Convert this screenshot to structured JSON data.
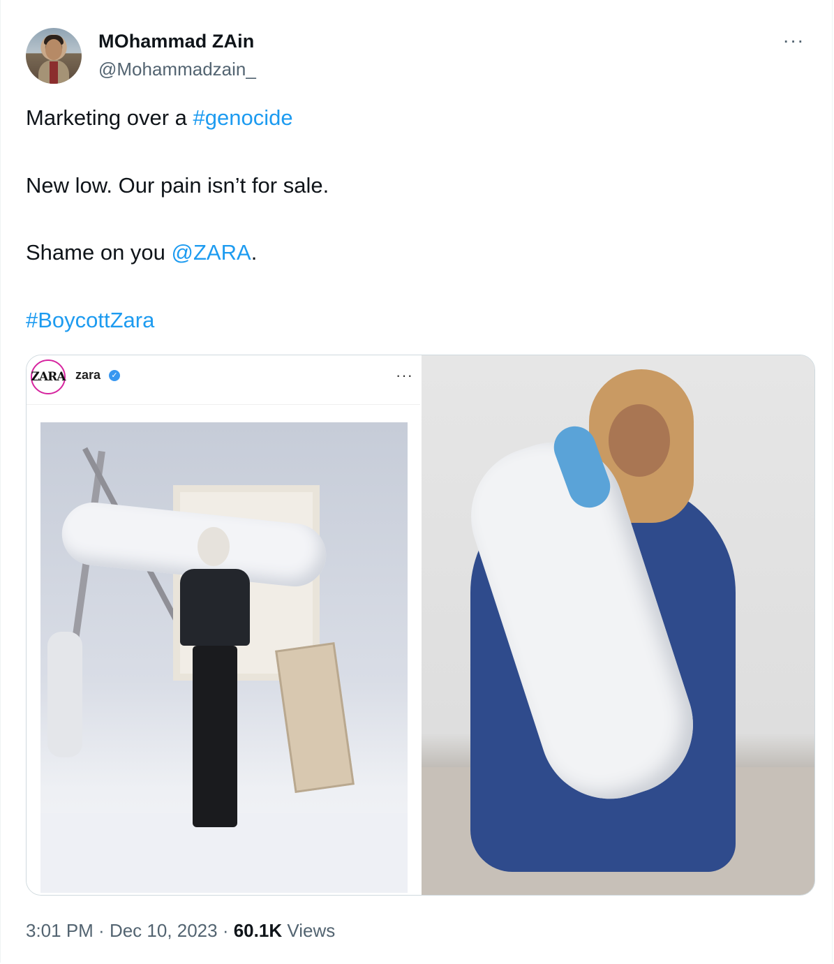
{
  "author": {
    "display_name": "MOhammad ZAin",
    "handle": "@Mohammadzain_"
  },
  "more_menu_label": "···",
  "tweet": {
    "line1_text": "Marketing over a ",
    "line1_hashtag": "#genocide",
    "line2_text": "New low. Our pain isn’t for sale.",
    "line3_text": "Shame on you ",
    "line3_mention": "@ZARA",
    "line3_suffix": ".",
    "line4_hashtag": "#BoycottZara"
  },
  "media": {
    "left": {
      "logo_text": "ZARA",
      "account_name": "zara",
      "verified_glyph": "✓",
      "more_label": "···"
    }
  },
  "footer": {
    "time": "3:01 PM",
    "sep1": " · ",
    "date": "Dec 10, 2023",
    "sep2": " · ",
    "views_count": "60.1K",
    "views_label": " Views"
  },
  "colors": {
    "link": "#1d9bf0",
    "secondary_text": "#536471",
    "primary_text": "#0f1419",
    "border": "#cfd9de"
  }
}
